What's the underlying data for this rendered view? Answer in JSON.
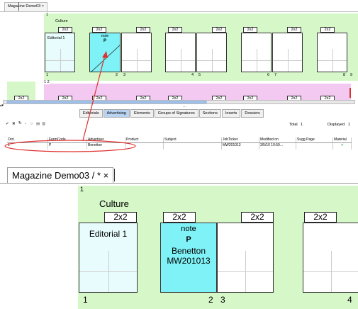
{
  "small_view": {
    "tab_title": "Magazine Demo03 ×",
    "section_number": "1",
    "section_name": "Culture",
    "page_format": "2x2",
    "editorial_label": "Editorial 1",
    "note_label": "note",
    "note_code": "P",
    "page_numbers": [
      "1",
      "2",
      "3",
      "4",
      "5",
      "6",
      "7",
      "8",
      "9"
    ],
    "second_row_number": "1 2",
    "tabs": [
      "Editorials",
      "Advertising",
      "Elements",
      "Groups of Signatures",
      "Sections",
      "Inserts",
      "Dossiers"
    ],
    "active_tab": "Advertising",
    "total_label": "Total",
    "total_value": "1",
    "displayed_label": "Displayed",
    "displayed_value": "1",
    "columns": [
      "Ord.",
      "FormCode",
      "Advertiser",
      "Product",
      "Subject",
      "JobTicket",
      "Modified on",
      "Sugg.Page",
      "Material"
    ],
    "row": [
      "1",
      "P",
      "Benetton",
      "",
      "",
      "MW201013",
      "3/5/10 10:59...",
      "",
      "✔"
    ]
  },
  "big_view": {
    "tab_title": "Magazine Demo03 / * ×",
    "section_number": "1",
    "section_name": "Culture",
    "page_format": "2x2",
    "editorial_label": "Editorial 1",
    "note_label": "note",
    "note_code": "P",
    "advertiser": "Benetton",
    "job_ticket": "MW201013",
    "page_numbers": [
      "1",
      "2",
      "3",
      "4"
    ]
  },
  "colors": {
    "accent_green": "#d6f7c8",
    "ad_cyan": "#7ef2f6",
    "highlight_red": "#e03030"
  }
}
